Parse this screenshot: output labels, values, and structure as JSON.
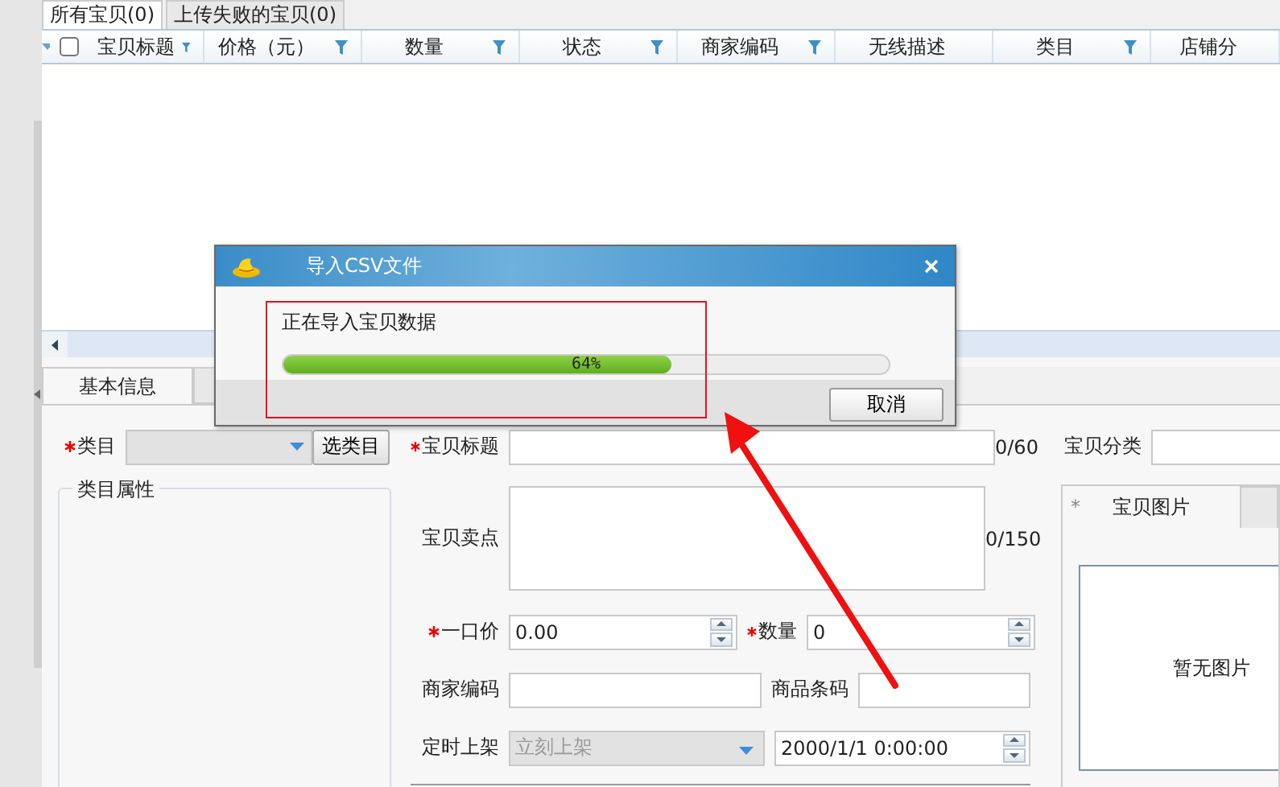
{
  "top_tabs": [
    {
      "label": "所有宝贝(0)",
      "selected": true
    },
    {
      "label": "上传失败的宝贝(0)",
      "selected": false
    }
  ],
  "table": {
    "select_all_checked": false,
    "columns": [
      {
        "label": "宝贝标题",
        "filter": true
      },
      {
        "label": "价格（元）",
        "filter": true
      },
      {
        "label": "数量",
        "filter": true
      },
      {
        "label": "状态",
        "filter": true
      },
      {
        "label": "商家编码",
        "filter": true
      },
      {
        "label": "无线描述",
        "filter": false
      },
      {
        "label": "类目",
        "filter": true
      },
      {
        "label": "店铺分",
        "filter": false
      }
    ]
  },
  "detail_tabs": [
    {
      "label": "基本信息",
      "selected": true
    }
  ],
  "form": {
    "category": {
      "label": "类目",
      "required": true,
      "button": "选类目"
    },
    "title": {
      "label": "宝贝标题",
      "required": true,
      "counter": "0/60"
    },
    "shop_category": {
      "label": "宝贝分类"
    },
    "attributes_group": {
      "label": "类目属性"
    },
    "selling_points": {
      "label": "宝贝卖点",
      "counter": "0/150"
    },
    "price": {
      "label": "一口价",
      "required": true,
      "value": "0.00"
    },
    "quantity": {
      "label": "数量",
      "required": true,
      "value": "0"
    },
    "merchant_code": {
      "label": "商家编码"
    },
    "barcode": {
      "label": "商品条码"
    },
    "schedule": {
      "label": "定时上架",
      "value": "立刻上架",
      "disabled": true,
      "datetime": "2000/1/1 0:00:00"
    }
  },
  "image_panel": {
    "tabs": [
      {
        "label": "宝贝图片",
        "marker": "*",
        "selected": true
      }
    ],
    "empty_text": "暂无图片"
  },
  "dialog": {
    "title": "导入CSV文件",
    "message": "正在导入宝贝数据",
    "progress": {
      "level": 0.64,
      "label": "64%"
    },
    "buttons": [
      "取消"
    ]
  }
}
